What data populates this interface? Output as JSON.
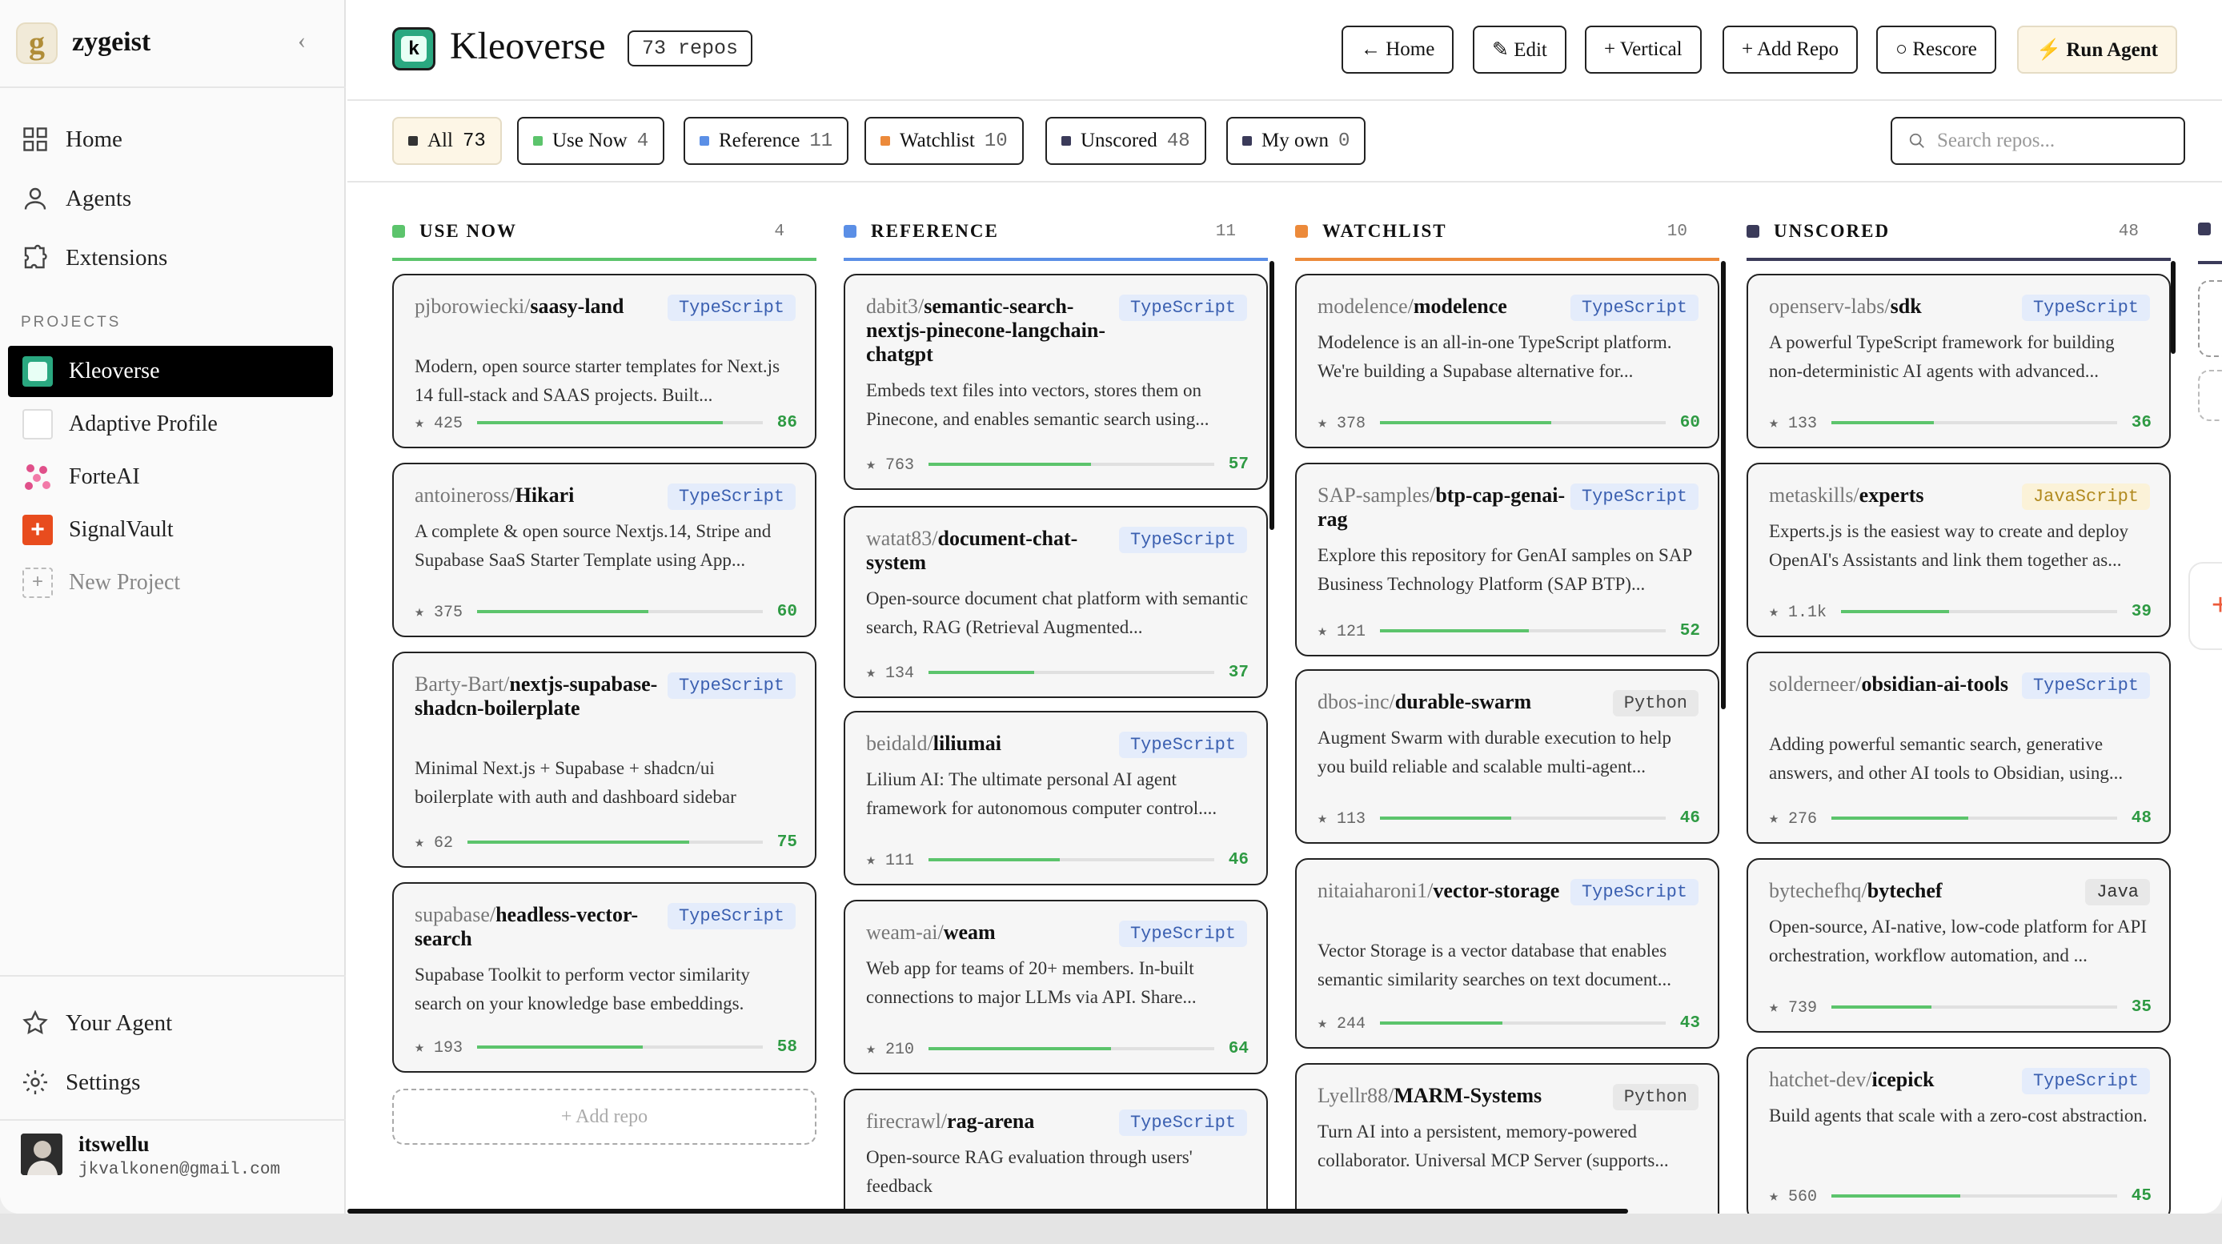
{
  "app": {
    "name": "zygeist",
    "logo_letter": "g"
  },
  "sidebar": {
    "nav": [
      {
        "label": "Home",
        "icon": "grid-icon"
      },
      {
        "label": "Agents",
        "icon": "user-icon"
      },
      {
        "label": "Extensions",
        "icon": "puzzle-icon"
      }
    ],
    "projects_heading": "PROJECTS",
    "projects": [
      {
        "label": "Kleoverse",
        "active": true
      },
      {
        "label": "Adaptive Profile",
        "active": false
      },
      {
        "label": "ForteAI",
        "active": false
      },
      {
        "label": "SignalVault",
        "active": false
      },
      {
        "label": "New Project",
        "active": false
      }
    ],
    "bottom": [
      {
        "label": "Your Agent",
        "icon": "star-icon"
      },
      {
        "label": "Settings",
        "icon": "gear-icon"
      }
    ],
    "user": {
      "name": "itswellu",
      "email": "jkvalkonen@gmail.com"
    }
  },
  "header": {
    "project_letter": "k",
    "title": "Kleoverse",
    "repo_count": "73 repos",
    "buttons": [
      "← Home",
      "✎ Edit",
      "+ Vertical",
      "+ Add Repo",
      "○ Rescore",
      "⚡ Run Agent"
    ]
  },
  "filters": {
    "chips": [
      {
        "label": "All",
        "count": "73",
        "color": "#333333"
      },
      {
        "label": "Use Now",
        "count": "4",
        "color": "#5cc46c"
      },
      {
        "label": "Reference",
        "count": "11",
        "color": "#5b8fe6"
      },
      {
        "label": "Watchlist",
        "count": "10",
        "color": "#ec8a3a"
      },
      {
        "label": "Unscored",
        "count": "48",
        "color": "#3b3b5a"
      },
      {
        "label": "My own",
        "count": "0",
        "color": "#3b3b5a"
      }
    ],
    "search_placeholder": "Search repos..."
  },
  "columns": [
    {
      "title": "USE NOW",
      "count": "4",
      "color": "#5cc46c",
      "cards": [
        {
          "owner": "pjborowiecki/",
          "name": "saasy-land",
          "lang": "TypeScript",
          "desc": "Modern, open source starter templates for Next.js 14 full-stack and SAAS projects. Built...",
          "stars": "★ 425",
          "score": "86"
        },
        {
          "owner": "antoineross/",
          "name": "Hikari",
          "lang": "TypeScript",
          "desc": "A complete & open source Nextjs.14, Stripe and Supabase SaaS Starter Template using App...",
          "stars": "★ 375",
          "score": "60"
        },
        {
          "owner": "Barty-Bart/",
          "name": "nextjs-supabase-shadcn-boilerplate",
          "lang": "TypeScript",
          "desc": "Minimal Next.js + Supabase + shadcn/ui boilerplate with auth and dashboard sidebar",
          "stars": "★ 62",
          "score": "75"
        },
        {
          "owner": "supabase/",
          "name": "headless-vector-search",
          "lang": "TypeScript",
          "desc": "Supabase Toolkit to perform vector similarity search on your knowledge base embeddings.",
          "stars": "★ 193",
          "score": "58"
        }
      ],
      "add_label": "+ Add repo"
    },
    {
      "title": "REFERENCE",
      "count": "11",
      "color": "#5b8fe6",
      "cards": [
        {
          "owner": "dabit3/",
          "name": "semantic-search-nextjs-pinecone-langchain-chatgpt",
          "lang": "TypeScript",
          "desc": "Embeds text files into vectors, stores them on Pinecone, and enables semantic search using...",
          "stars": "★ 763",
          "score": "57"
        },
        {
          "owner": "watat83/",
          "name": "document-chat-system",
          "lang": "TypeScript",
          "desc": "Open-source document chat platform with semantic search, RAG (Retrieval Augmented...",
          "stars": "★ 134",
          "score": "37"
        },
        {
          "owner": "beidald/",
          "name": "liliumai",
          "lang": "TypeScript",
          "desc": "Lilium AI: The ultimate personal AI agent framework for autonomous computer control....",
          "stars": "★ 111",
          "score": "46"
        },
        {
          "owner": "weam-ai/",
          "name": "weam",
          "lang": "TypeScript",
          "desc": "Web app for teams of 20+ members. In-built connections to major LLMs via API. Share...",
          "stars": "★ 210",
          "score": "64"
        },
        {
          "owner": "firecrawl/",
          "name": "rag-arena",
          "lang": "TypeScript",
          "desc": "Open-source RAG evaluation through users' feedback",
          "stars": "",
          "score": ""
        }
      ]
    },
    {
      "title": "WATCHLIST",
      "count": "10",
      "color": "#ec8a3a",
      "cards": [
        {
          "owner": "modelence/",
          "name": "modelence",
          "lang": "TypeScript",
          "desc": "Modelence is an all-in-one TypeScript platform. We're building a Supabase alternative for...",
          "stars": "★ 378",
          "score": "60"
        },
        {
          "owner": "SAP-samples/",
          "name": "btp-cap-genai-rag",
          "lang": "TypeScript",
          "desc": "Explore this repository for GenAI samples on SAP Business Technology Platform (SAP BTP)...",
          "stars": "★ 121",
          "score": "52"
        },
        {
          "owner": "dbos-inc/",
          "name": "durable-swarm",
          "lang": "Python",
          "desc": "Augment Swarm with durable execution to help you build reliable and scalable multi-agent...",
          "stars": "★ 113",
          "score": "46"
        },
        {
          "owner": "nitaiaharoni1/",
          "name": "vector-storage",
          "lang": "TypeScript",
          "desc": "Vector Storage is a vector database that enables semantic similarity searches on text document...",
          "stars": "★ 244",
          "score": "43"
        },
        {
          "owner": "Lyellr88/",
          "name": "MARM-Systems",
          "lang": "Python",
          "desc": "Turn AI into a persistent, memory-powered collaborator. Universal MCP Server (supports...",
          "stars": "",
          "score": ""
        }
      ]
    },
    {
      "title": "UNSCORED",
      "count": "48",
      "color": "#3b3b5a",
      "cards": [
        {
          "owner": "openserv-labs/",
          "name": "sdk",
          "lang": "TypeScript",
          "desc": "A powerful TypeScript framework for building non-deterministic AI agents with advanced...",
          "stars": "★ 133",
          "score": "36"
        },
        {
          "owner": "metaskills/",
          "name": "experts",
          "lang": "JavaScript",
          "desc": "Experts.js is the easiest way to create and deploy OpenAI's Assistants and link them together as...",
          "stars": "★ 1.1k",
          "score": "39"
        },
        {
          "owner": "solderneer/",
          "name": "obsidian-ai-tools",
          "lang": "TypeScript",
          "desc": "Adding powerful semantic search, generative answers, and other AI tools to Obsidian, using...",
          "stars": "★ 276",
          "score": "48"
        },
        {
          "owner": "bytechefhq/",
          "name": "bytechef",
          "lang": "Java",
          "desc": "Open-source, AI-native, low-code platform for API orchestration, workflow automation, and ...",
          "stars": "★ 739",
          "score": "35"
        },
        {
          "owner": "hatchet-dev/",
          "name": "icepick",
          "lang": "TypeScript",
          "desc": "Build agents that scale with a zero-cost abstraction.",
          "stars": "★ 560",
          "score": "45"
        }
      ]
    }
  ],
  "next_column_add": "+"
}
